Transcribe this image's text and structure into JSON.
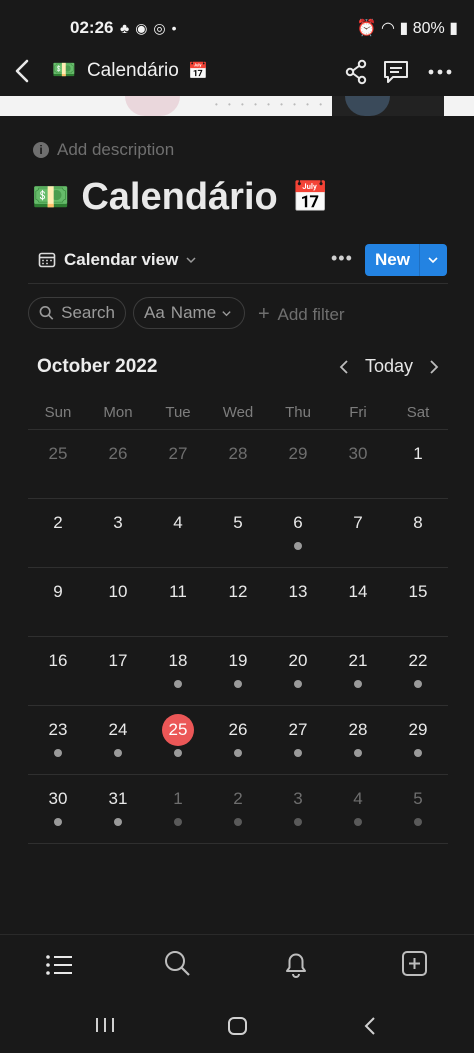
{
  "status_bar": {
    "time": "02:26",
    "battery": "80%"
  },
  "topbar": {
    "emoji": "💵",
    "title": "Calendário",
    "title_emoji": "📅"
  },
  "page": {
    "add_description": "Add description",
    "title_emoji": "💵",
    "title": "Calendário",
    "title_emoji_right": "📅"
  },
  "view": {
    "label": "Calendar view",
    "new_label": "New"
  },
  "filters": {
    "search": "Search",
    "name_prefix": "Aa",
    "name": "Name",
    "add_filter": "Add filter"
  },
  "calendar": {
    "month_label": "October 2022",
    "today_label": "Today",
    "weekdays": [
      "Sun",
      "Mon",
      "Tue",
      "Wed",
      "Thu",
      "Fri",
      "Sat"
    ],
    "weeks": [
      [
        {
          "d": "25",
          "m": false,
          "dot": false
        },
        {
          "d": "26",
          "m": false,
          "dot": false
        },
        {
          "d": "27",
          "m": false,
          "dot": false
        },
        {
          "d": "28",
          "m": false,
          "dot": false
        },
        {
          "d": "29",
          "m": false,
          "dot": false
        },
        {
          "d": "30",
          "m": false,
          "dot": false
        },
        {
          "d": "1",
          "m": true,
          "dot": false
        }
      ],
      [
        {
          "d": "2",
          "m": true,
          "dot": false
        },
        {
          "d": "3",
          "m": true,
          "dot": false
        },
        {
          "d": "4",
          "m": true,
          "dot": false
        },
        {
          "d": "5",
          "m": true,
          "dot": false
        },
        {
          "d": "6",
          "m": true,
          "dot": true
        },
        {
          "d": "7",
          "m": true,
          "dot": false
        },
        {
          "d": "8",
          "m": true,
          "dot": false
        }
      ],
      [
        {
          "d": "9",
          "m": true,
          "dot": false
        },
        {
          "d": "10",
          "m": true,
          "dot": false
        },
        {
          "d": "11",
          "m": true,
          "dot": false
        },
        {
          "d": "12",
          "m": true,
          "dot": false
        },
        {
          "d": "13",
          "m": true,
          "dot": false
        },
        {
          "d": "14",
          "m": true,
          "dot": false
        },
        {
          "d": "15",
          "m": true,
          "dot": false
        }
      ],
      [
        {
          "d": "16",
          "m": true,
          "dot": false
        },
        {
          "d": "17",
          "m": true,
          "dot": false
        },
        {
          "d": "18",
          "m": true,
          "dot": true
        },
        {
          "d": "19",
          "m": true,
          "dot": true
        },
        {
          "d": "20",
          "m": true,
          "dot": true
        },
        {
          "d": "21",
          "m": true,
          "dot": true
        },
        {
          "d": "22",
          "m": true,
          "dot": true
        }
      ],
      [
        {
          "d": "23",
          "m": true,
          "dot": true
        },
        {
          "d": "24",
          "m": true,
          "dot": true
        },
        {
          "d": "25",
          "m": true,
          "dot": true,
          "today": true
        },
        {
          "d": "26",
          "m": true,
          "dot": true
        },
        {
          "d": "27",
          "m": true,
          "dot": true
        },
        {
          "d": "28",
          "m": true,
          "dot": true
        },
        {
          "d": "29",
          "m": true,
          "dot": true
        }
      ],
      [
        {
          "d": "30",
          "m": true,
          "dot": true
        },
        {
          "d": "31",
          "m": true,
          "dot": true
        },
        {
          "d": "1",
          "m": false,
          "dot": true
        },
        {
          "d": "2",
          "m": false,
          "dot": true
        },
        {
          "d": "3",
          "m": false,
          "dot": true
        },
        {
          "d": "4",
          "m": false,
          "dot": true
        },
        {
          "d": "5",
          "m": false,
          "dot": true
        }
      ]
    ]
  },
  "colors": {
    "accent": "#2383e2",
    "today": "#eb5757",
    "background": "#191919"
  },
  "bottom_nav": [
    "list-icon",
    "search-icon",
    "bell-icon",
    "plus-square-icon"
  ]
}
